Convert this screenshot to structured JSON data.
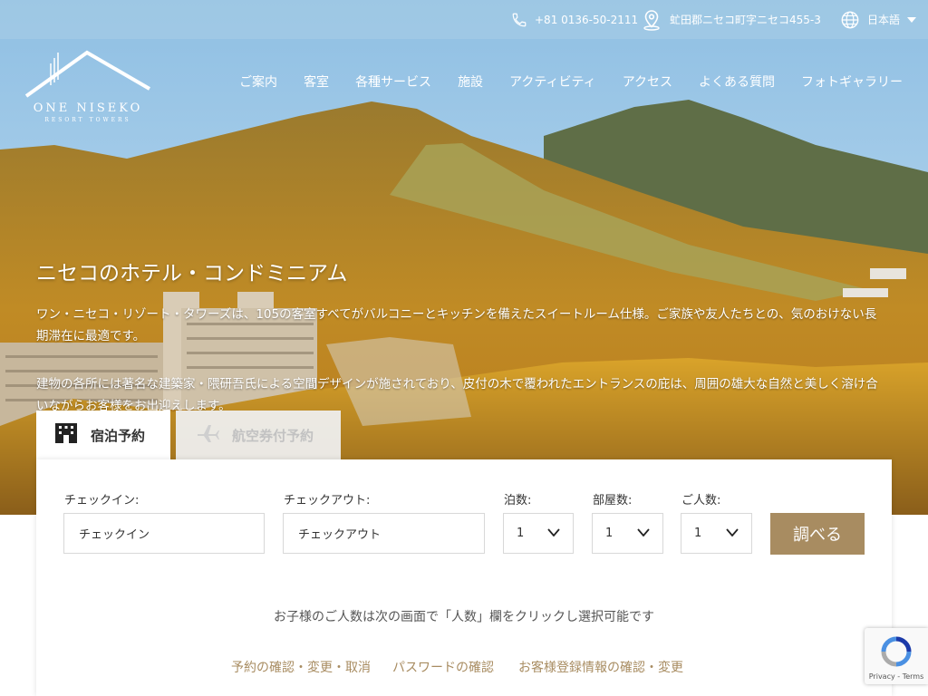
{
  "topbar": {
    "phone": "+81 0136-50-2111",
    "address": "虻田郡ニセコ町字ニセコ455-3",
    "language": "日本語",
    "icons": {
      "phone": "phone-icon",
      "location": "location-pin-icon",
      "globe": "globe-icon",
      "caret": "caret-down-icon"
    }
  },
  "logo": {
    "line1": "ONE NISEKO",
    "line2": "RESORT TOWERS"
  },
  "nav": [
    "ご案内",
    "客室",
    "各種サービス",
    "施設",
    "アクティビティ",
    "アクセス",
    "よくある質問",
    "フォトギャラリー"
  ],
  "hero": {
    "headline": "ニセコのホテル・コンドミニアム",
    "para1": "ワン・ニセコ・リゾート・タワーズは、105の客室すべてがバルコニーとキッチンを備えたスイートルーム仕様。ご家族や友人たちとの、気のおけない長期滞在に最適です。",
    "para2": "建物の各所には著名な建築家・隈研吾氏による空間デザインが施されており、皮付の木で覆われたエントランスの庇は、周囲の雄大な自然と美しく溶け合いながらお客様をお出迎えします。"
  },
  "tabs": [
    {
      "label": "宿泊予約",
      "icon": "hotel-icon",
      "active": true
    },
    {
      "label": "航空券付予約",
      "icon": "airplane-icon",
      "active": false
    }
  ],
  "form": {
    "checkin_label": "チェックイン:",
    "checkin_placeholder": "チェックイン",
    "checkout_label": "チェックアウト:",
    "checkout_placeholder": "チェックアウト",
    "nights_label": "泊数:",
    "nights_value": "1",
    "rooms_label": "部屋数:",
    "rooms_value": "1",
    "guests_label": "ご人数:",
    "guests_value": "1",
    "search_label": "調べる"
  },
  "note": "お子様のご人数は次の画面で「人数」欄をクリックし選択可能です",
  "links": [
    "予約の確認・変更・取消",
    "パスワードの確認",
    "お客様登録情報の確認・変更"
  ],
  "recaptcha": {
    "terms": "Privacy - Terms"
  },
  "colors": {
    "accent": "#a88c61",
    "topbar": "#aacde6"
  }
}
